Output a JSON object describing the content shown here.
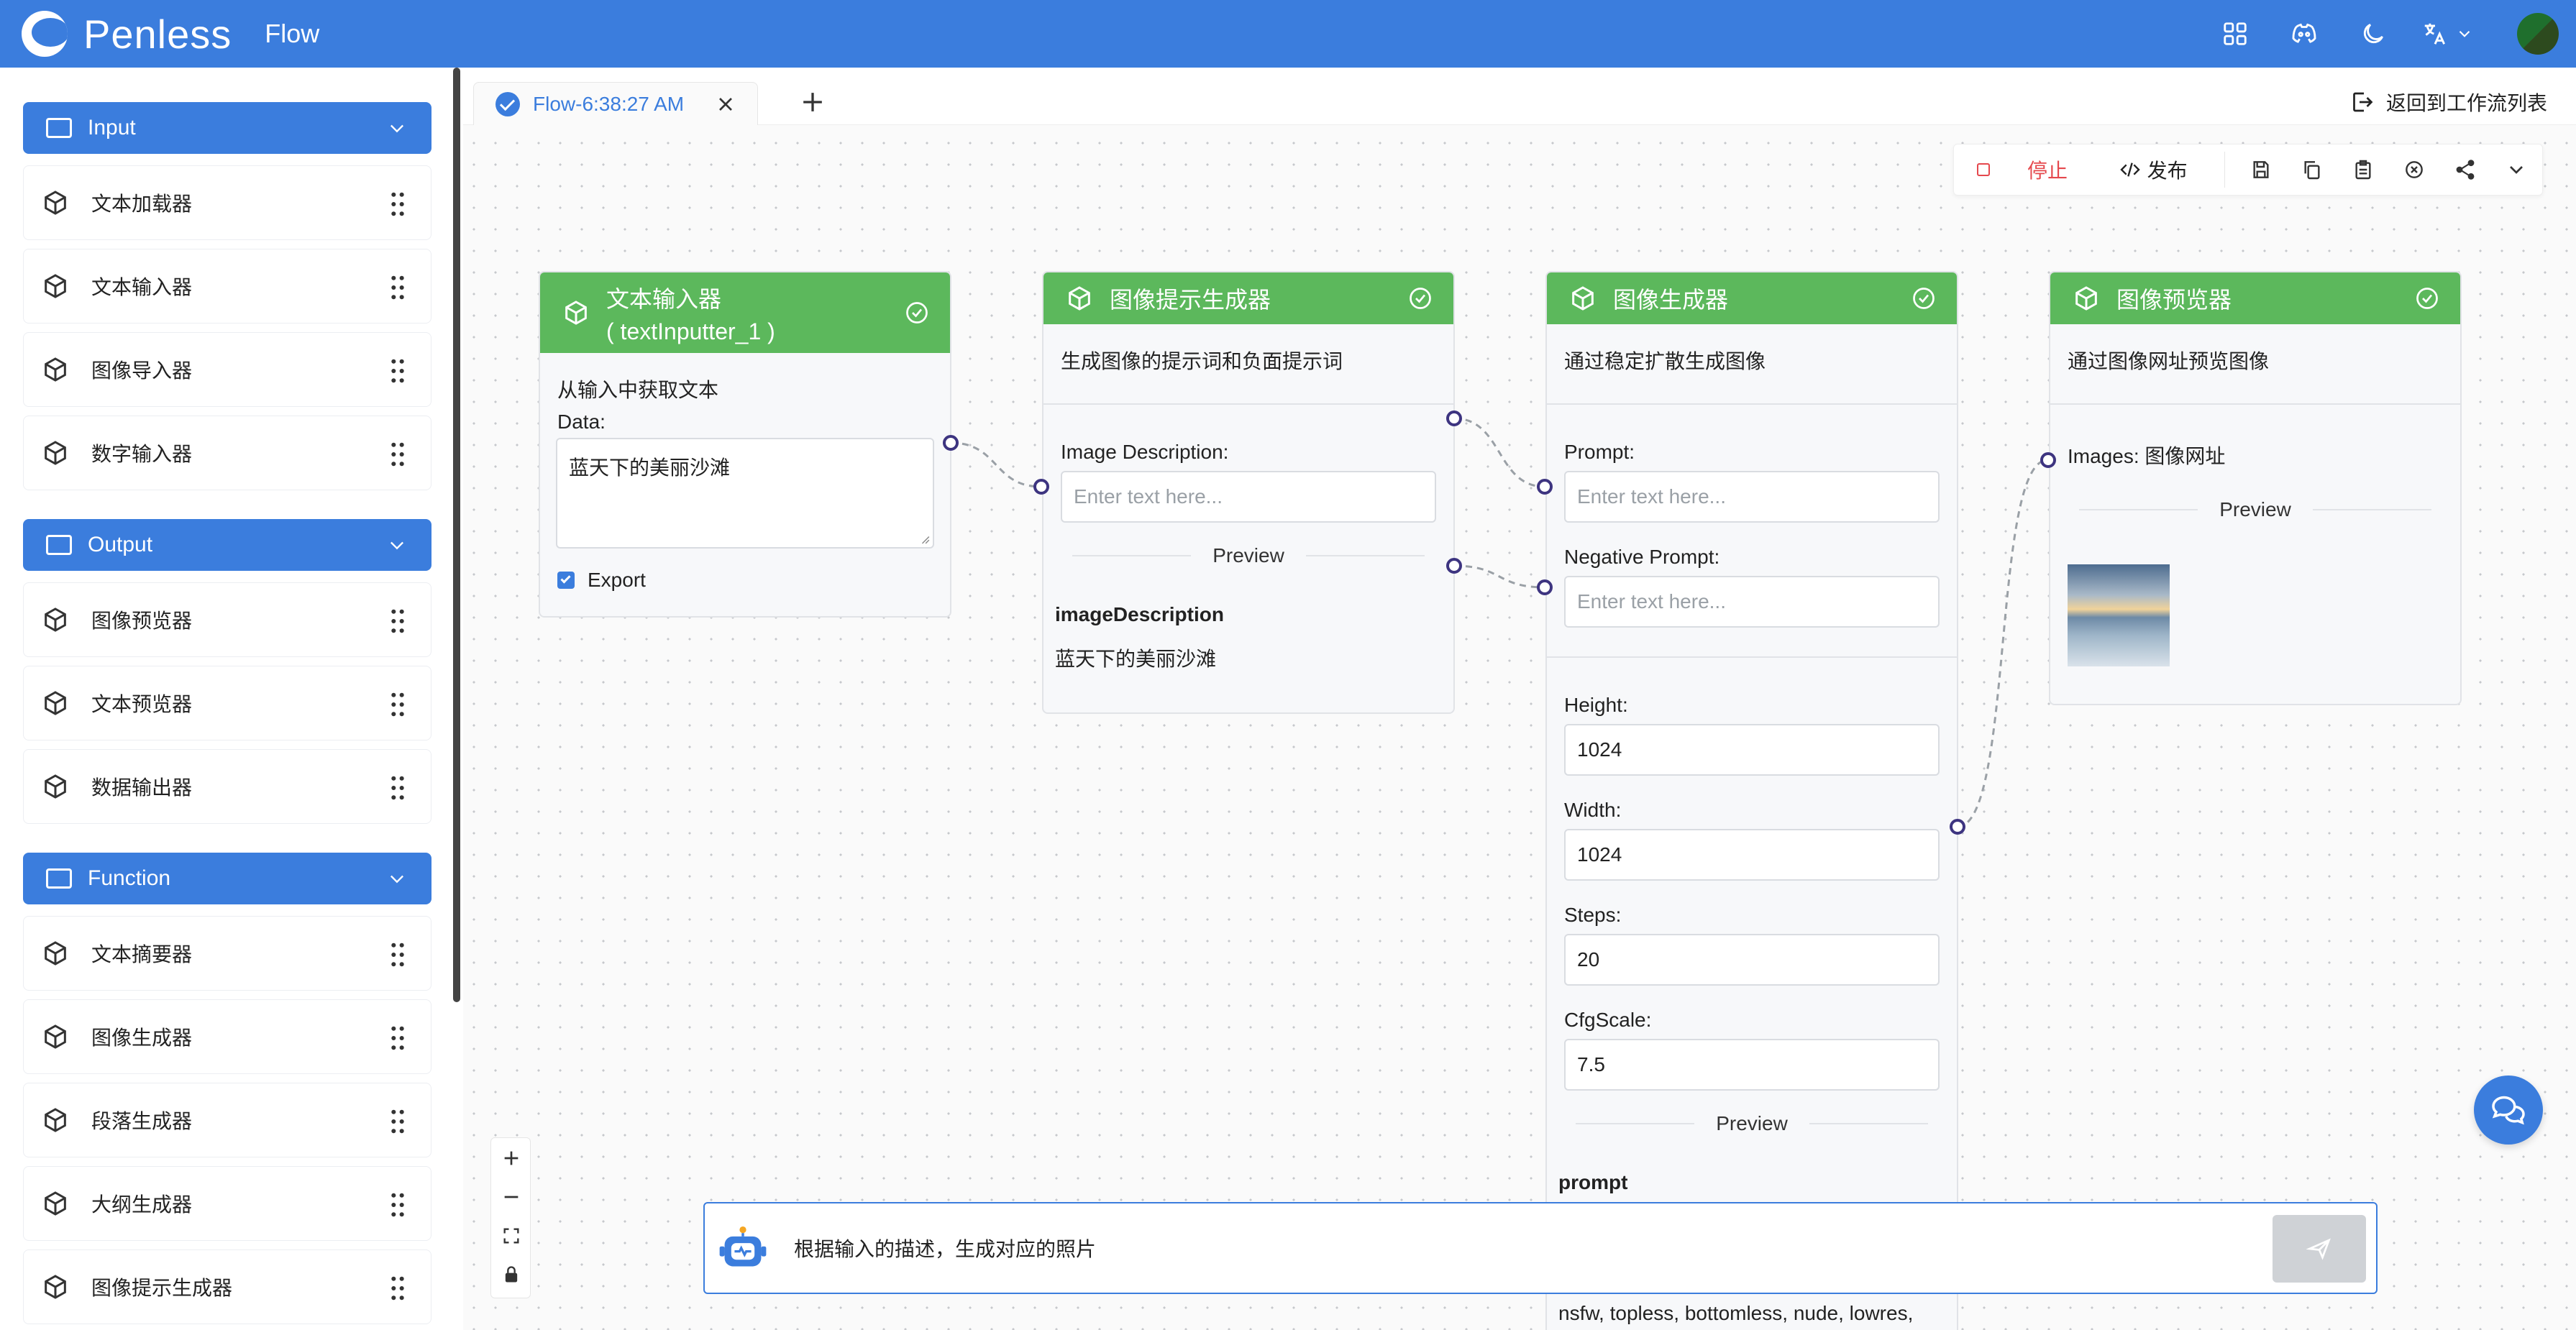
{
  "app": {
    "brand": "Penless",
    "section": "Flow"
  },
  "sidebar": {
    "groups": [
      {
        "title": "Input",
        "items": [
          "文本加载器",
          "文本输入器",
          "图像导入器",
          "数字输入器"
        ]
      },
      {
        "title": "Output",
        "items": [
          "图像预览器",
          "文本预览器",
          "数据输出器"
        ]
      },
      {
        "title": "Function",
        "items": [
          "文本摘要器",
          "图像生成器",
          "段落生成器",
          "大纲生成器",
          "图像提示生成器"
        ]
      }
    ]
  },
  "tabs": {
    "active_label": "Flow-6:38:27 AM",
    "back_label": "返回到工作流列表"
  },
  "toolbar": {
    "stop_label": "停止",
    "publish_label": "发布"
  },
  "nodes": {
    "text_input": {
      "title_line1": "文本输入器",
      "title_line2": "( textInputter_1 )",
      "desc": "从输入中获取文本",
      "data_label": "Data:",
      "data_value": "蓝天下的美丽沙滩",
      "export_label": "Export",
      "export_checked": true
    },
    "prompt_gen": {
      "title": "图像提示生成器",
      "desc": "生成图像的提示词和负面提示词",
      "field_label": "Image Description:",
      "field_placeholder": "Enter text here...",
      "preview_label": "Preview",
      "result_key": "imageDescription",
      "result_value": "蓝天下的美丽沙滩"
    },
    "image_gen": {
      "title": "图像生成器",
      "desc": "通过稳定扩散生成图像",
      "prompt_label": "Prompt:",
      "prompt_placeholder": "Enter text here...",
      "neg_label": "Negative Prompt:",
      "neg_placeholder": "Enter text here...",
      "height_label": "Height:",
      "height_value": "1024",
      "width_label": "Width:",
      "width_value": "1024",
      "steps_label": "Steps:",
      "steps_value": "20",
      "cfg_label": "CfgScale:",
      "cfg_value": "7.5",
      "preview_label": "Preview",
      "result_key": "prompt",
      "result_tail": "nsfw, topless, bottomless, nude, lowres,"
    },
    "image_preview": {
      "title": "图像预览器",
      "desc": "通过图像网址预览图像",
      "images_label": "Images: 图像网址",
      "preview_label": "Preview"
    }
  },
  "chat": {
    "message": "根据输入的描述，生成对应的照片"
  },
  "colors": {
    "primary": "#3b7ddd",
    "node_header": "#5cb85c",
    "stop": "#e5484d",
    "port": "#3d3480"
  },
  "icons": [
    "apps-icon",
    "discord-icon",
    "moon-icon",
    "translate-icon",
    "cube-icon",
    "drag-handle-icon",
    "check-circle-icon",
    "chat-icon",
    "robot-icon",
    "send-icon"
  ]
}
